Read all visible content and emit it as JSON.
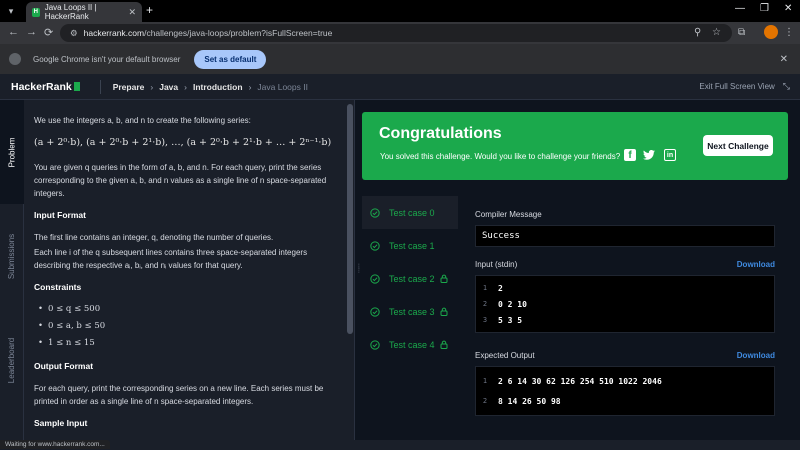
{
  "browser": {
    "tab_title": "Java Loops II | HackerRank",
    "tab_favicon": "H",
    "new_tab": "+",
    "url_host": "hackerrank.com",
    "url_path": "/challenges/java-loops/problem?isFullScreen=true",
    "banner_text": "Google Chrome isn't your default browser",
    "banner_button": "Set as default"
  },
  "header": {
    "logo": "HackerRank",
    "breadcrumbs": [
      "Prepare",
      "Java",
      "Introduction"
    ],
    "breadcrumb_current": "Java Loops II",
    "exit_fullscreen": "Exit Full Screen View"
  },
  "sidetabs": [
    "Problem",
    "Submissions",
    "Leaderboard"
  ],
  "problem": {
    "intro": "We use the integers a, b, and n to create the following series:",
    "formula": "(a + 2⁰·b), (a + 2⁰·b + 2¹·b), …, (a + 2⁰·b + 2¹·b + … + 2ⁿ⁻¹·b)",
    "queries_text": "You are given q queries in the form of a, b, and n. For each query, print the series corresponding to the given a, b, and n values as a single line of n space-separated integers.",
    "input_format_title": "Input Format",
    "input_format_1": "The first line contains an integer, q, denoting the number of queries.",
    "input_format_2": "Each line i of the q subsequent lines contains three space-separated integers describing the respective aᵢ, bᵢ, and nᵢ values for that query.",
    "constraints_title": "Constraints",
    "constraints": [
      "0 ≤ q ≤ 500",
      "0 ≤ a, b ≤ 50",
      "1 ≤ n ≤ 15"
    ],
    "output_format_title": "Output Format",
    "output_format": "For each query, print the corresponding series on a new line. Each series must be printed in order as a single line of n space-separated integers.",
    "sample_input_title": "Sample Input"
  },
  "congrats": {
    "title": "Congratulations",
    "message": "You solved this challenge. Would you like to challenge your friends?",
    "next_button": "Next Challenge",
    "fb": "f",
    "twitter": "🐦",
    "linkedin": "in",
    "color": "#1ba94c"
  },
  "testcases": [
    {
      "label": "Test case 0",
      "locked": false
    },
    {
      "label": "Test case 1",
      "locked": false
    },
    {
      "label": "Test case 2",
      "locked": true
    },
    {
      "label": "Test case 3",
      "locked": true
    },
    {
      "label": "Test case 4",
      "locked": true
    }
  ],
  "results": {
    "compiler_label": "Compiler Message",
    "compiler_message": "Success",
    "input_label": "Input (stdin)",
    "download": "Download",
    "input_lines": [
      {
        "n": "1",
        "text": "2"
      },
      {
        "n": "2",
        "text": "0 2 10"
      },
      {
        "n": "3",
        "text": "5 3 5"
      }
    ],
    "expected_label": "Expected Output",
    "expected_lines": [
      {
        "n": "1",
        "text": "2 6 14 30 62 126 254 510 1022 2046"
      },
      {
        "n": "2",
        "text": "8 14 26 50 98"
      }
    ]
  },
  "status": "Waiting for www.hackerrank.com..."
}
